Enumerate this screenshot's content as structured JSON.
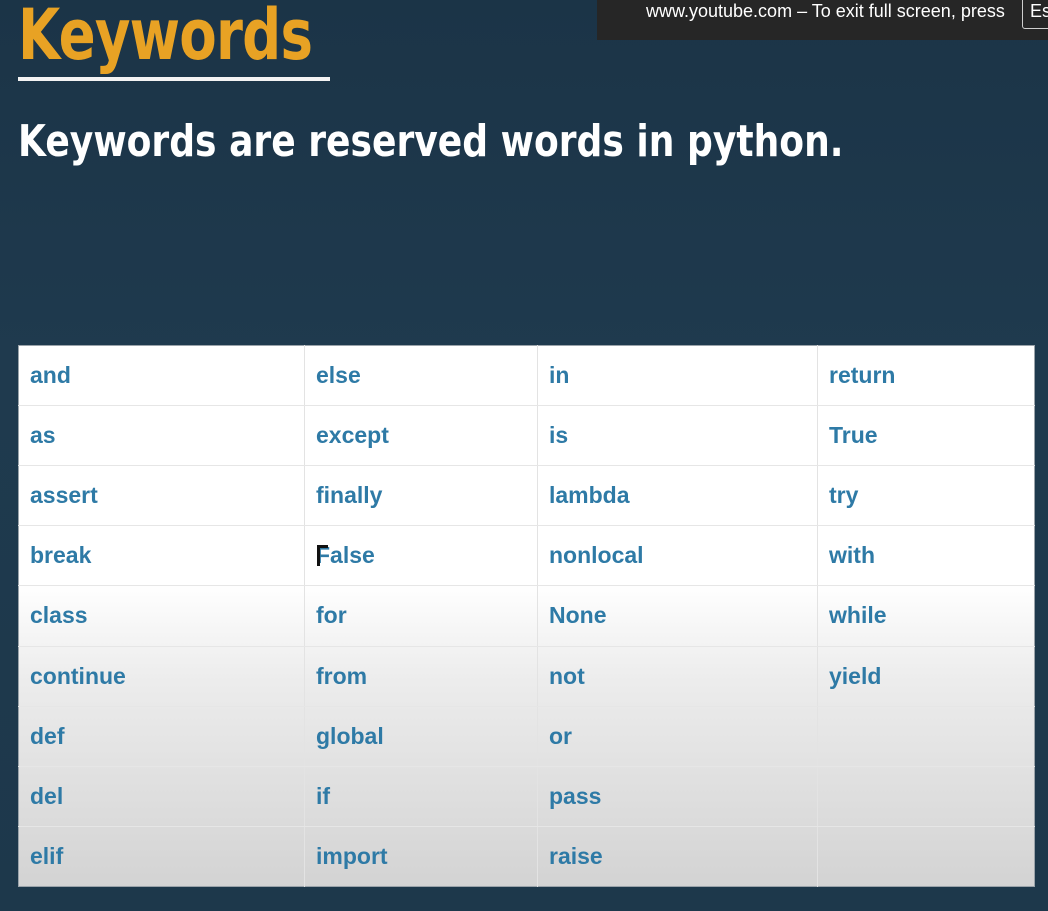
{
  "slide": {
    "title": "Keywords",
    "subtitle": "Keywords are reserved words in python."
  },
  "fullscreen_notice": {
    "text": "www.youtube.com – To exit full screen, press",
    "key": "Es"
  },
  "keywords_table": {
    "rows": [
      [
        "and",
        "else",
        "in",
        "return"
      ],
      [
        "as",
        "except",
        "is",
        "True"
      ],
      [
        "assert",
        "finally",
        "lambda",
        "try"
      ],
      [
        "break",
        "False",
        "nonlocal",
        "with"
      ],
      [
        "class",
        "for",
        "None",
        "while"
      ],
      [
        "continue",
        "from",
        "not",
        "yield"
      ],
      [
        "def",
        "global",
        "or",
        ""
      ],
      [
        "del",
        "if",
        "pass",
        ""
      ],
      [
        "elif",
        "import",
        "raise",
        ""
      ]
    ]
  },
  "colors": {
    "background": "#1f3a4e",
    "title": "#e8a224",
    "keyword_text": "#2e7aa6",
    "notice_bg": "#262626"
  }
}
